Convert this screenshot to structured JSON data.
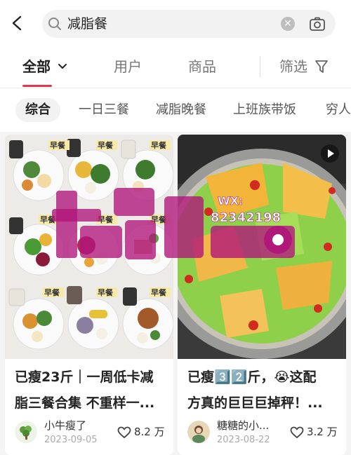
{
  "search": {
    "query": "减脂餐"
  },
  "tabs": [
    {
      "label": "全部"
    },
    {
      "label": "用户"
    },
    {
      "label": "商品"
    },
    {
      "label": "筛选"
    }
  ],
  "chips": [
    {
      "label": "综合"
    },
    {
      "label": "一日三餐"
    },
    {
      "label": "减脂晚餐"
    },
    {
      "label": "上班族带饭"
    },
    {
      "label": "穷人"
    }
  ],
  "photo_tag": "早餐",
  "posts": [
    {
      "title_line1": "已瘦23斤｜一周低卡减",
      "title_line2": "脂三餐合集 不重样一...",
      "author": "小牛瘦了",
      "date": "2023-09-05",
      "likes": "8.2 万"
    },
    {
      "title_line1": "已瘦3️⃣2️⃣斤，😭这配",
      "title_line2": "方真的巨巨巨掉秤！...",
      "author": "糖糖的小...",
      "date": "2023-08-22",
      "likes": "3.2 万"
    }
  ],
  "watermark": {
    "line1": "WX:",
    "line2": "82342198"
  },
  "colors": {
    "accent": "#e9334e",
    "watermark": "#b0147a"
  }
}
